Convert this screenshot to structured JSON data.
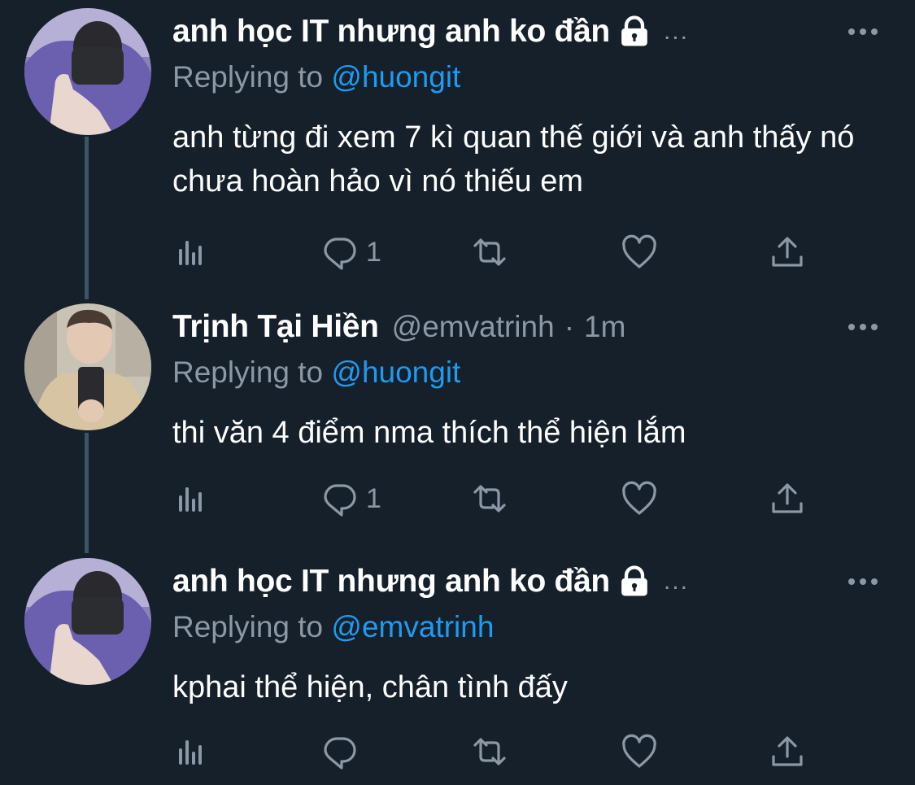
{
  "thread": [
    {
      "display_name": "anh học IT nhưng anh ko đần",
      "protected": true,
      "handle": "",
      "time": "",
      "truncated": "...",
      "replying_prefix": "Replying to ",
      "replying_to": "@huongit",
      "text": "anh từng đi xem 7 kì quan thế giới và anh thấy nó chưa hoàn hảo vì nó thiếu em",
      "reply_count": "1",
      "avatar_icon": "avatar-masked-hoodie"
    },
    {
      "display_name": "Trịnh Tại Hiền",
      "protected": false,
      "handle": "@emvatrinh",
      "separator": "·",
      "time": "1m",
      "replying_prefix": "Replying to ",
      "replying_to": "@huongit",
      "text": "thi văn 4 điểm nma thích thể hiện lắm",
      "reply_count": "1",
      "avatar_icon": "avatar-mirror-selfie"
    },
    {
      "display_name": "anh học IT nhưng anh ko đần",
      "protected": true,
      "handle": "",
      "time": "",
      "truncated": "...",
      "replying_prefix": "Replying to ",
      "replying_to": "@emvatrinh",
      "text": "kphai thể hiện, chân tình đấy",
      "reply_count": "",
      "avatar_icon": "avatar-masked-hoodie"
    }
  ],
  "action_icons": [
    "analytics-icon",
    "reply-icon",
    "retweet-icon",
    "like-icon",
    "share-icon"
  ],
  "colors": {
    "background": "#15202b",
    "text": "#ffffff",
    "secondary": "#8b98a5",
    "link": "#1d9bf0",
    "thread_line": "#3d5466"
  }
}
